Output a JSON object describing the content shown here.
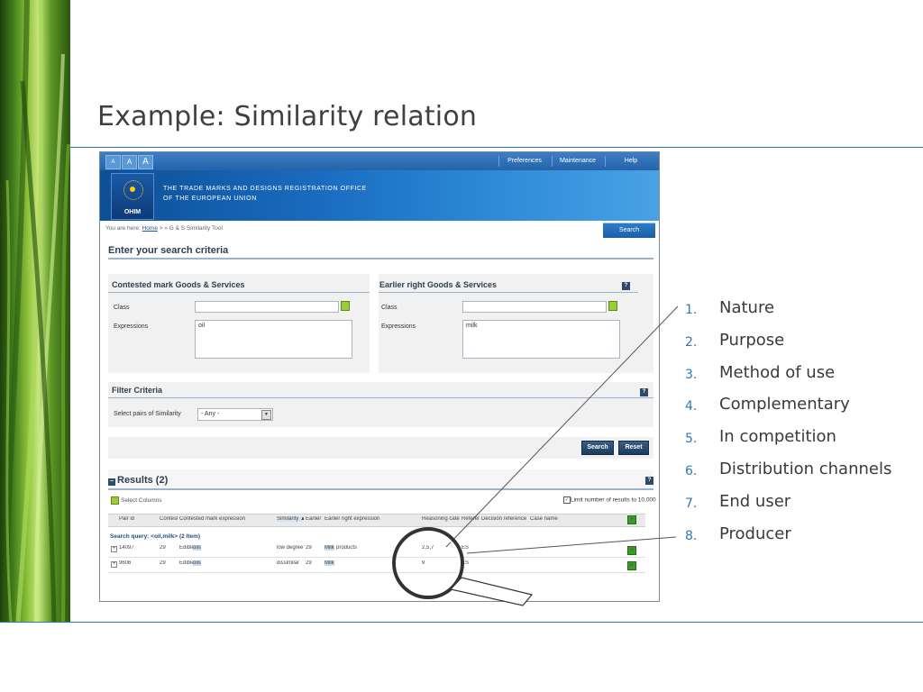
{
  "slide": {
    "title": "Example: Similarity relation"
  },
  "app": {
    "font_buttons": [
      "A",
      "A",
      "A"
    ],
    "nav": [
      "Preferences",
      "Maintenance",
      "Help"
    ],
    "logo_text": "OHIM",
    "office_line1": "The Trade Marks and Designs Registration Office",
    "office_line2": "of the European Union",
    "search_tab": "Search",
    "breadcrumb_prefix": "You are here:",
    "breadcrumb_home": "Home",
    "breadcrumb_rest": "> » G & S Similarity Tool",
    "heading": "Enter your search criteria",
    "contested": {
      "title": "Contested mark Goods & Services",
      "class_label": "Class",
      "class_value": "",
      "expr_label": "Expressions",
      "expr_value": "oil"
    },
    "earlier": {
      "title": "Earlier right Goods & Services",
      "class_label": "Class",
      "class_value": "",
      "expr_label": "Expressions",
      "expr_value": "milk"
    },
    "filter": {
      "title": "Filter Criteria",
      "label": "Select pairs of Similarity",
      "selected": "- Any -"
    },
    "buttons": {
      "search": "Search",
      "reset": "Reset"
    },
    "results": {
      "title": "Results (2)",
      "select_columns": "Select Columns",
      "limit_label": "Limit number of results to 10,000",
      "columns": [
        "Pair id",
        "Contest",
        "Contested mark expression",
        "Similarity ▲",
        "Earlier r",
        "Earlier right expression",
        "Reasoning categ",
        "Referen",
        "Decision reference nu",
        "Case name"
      ],
      "query_label": "Search query: <oil,milk> (2 Item)",
      "rows": [
        {
          "pair_id": "14097",
          "contest": "29",
          "contested_pre": "Edible",
          "contested_hl": "oils",
          "similarity": "low degree",
          "earlier_class": "29",
          "earlier_hl": "Milk",
          "earlier_post": "products",
          "reasoning": "2,5,7",
          "reference": "ES"
        },
        {
          "pair_id": "9606",
          "contest": "29",
          "contested_pre": "Edible",
          "contested_hl": "oils",
          "similarity": "dissimilar",
          "earlier_class": "29",
          "earlier_hl": "Milk",
          "earlier_post": "",
          "reasoning": "9",
          "reference": "ES"
        }
      ]
    }
  },
  "criteria": [
    {
      "num": "1.",
      "label": "Nature"
    },
    {
      "num": "2.",
      "label": "Purpose"
    },
    {
      "num": "3.",
      "label": "Method of use"
    },
    {
      "num": "4.",
      "label": "Complementary"
    },
    {
      "num": "5.",
      "label": "In competition"
    },
    {
      "num": "6.",
      "label": "Distribution channels"
    },
    {
      "num": "7.",
      "label": "End user"
    },
    {
      "num": "8.",
      "label": "Producer"
    }
  ],
  "colors": {
    "accent": "#2f78b8",
    "header_blue": "#1a6cc0",
    "text": "#3a3a3a"
  }
}
